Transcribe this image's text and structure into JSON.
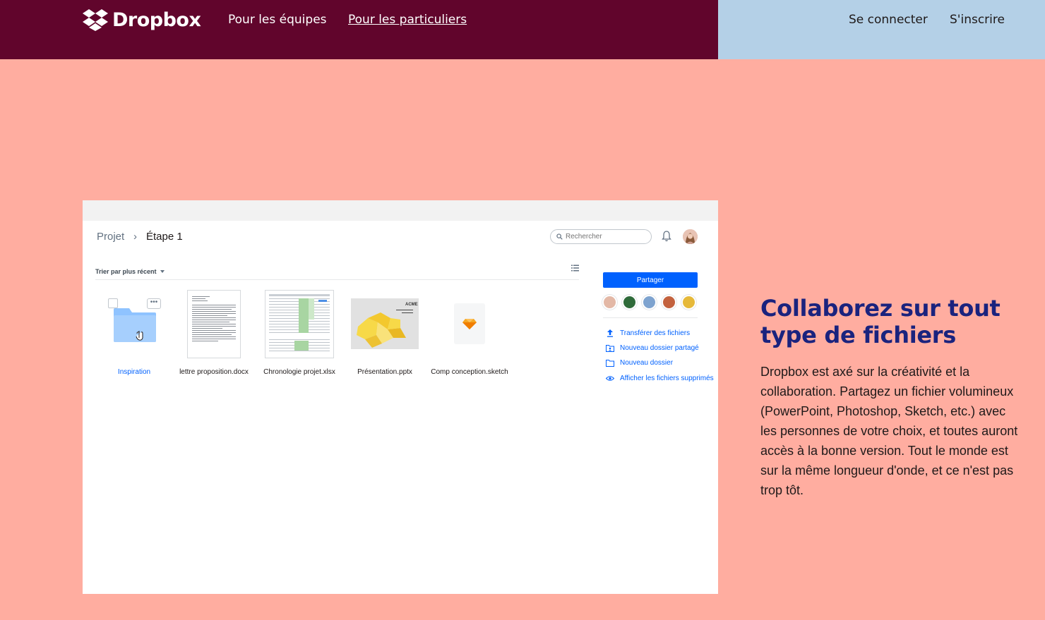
{
  "header": {
    "logo_text": "Dropbox",
    "nav": [
      {
        "label": "Pour les équipes"
      },
      {
        "label": "Pour les particuliers"
      }
    ],
    "login": "Se connecter",
    "signup": "S'inscrire"
  },
  "app": {
    "breadcrumb": {
      "project": "Projet",
      "separator": "›",
      "step": "Étape 1"
    },
    "search_placeholder": "Rechercher",
    "sort_label": "Trier par plus récent",
    "files": [
      {
        "name": "Inspiration"
      },
      {
        "name": "lettre proposition.docx"
      },
      {
        "name": "Chronologie projet.xlsx"
      },
      {
        "name": "Présentation.pptx"
      },
      {
        "name": "Comp conception.sketch"
      }
    ],
    "presentation_brand": "ACME",
    "share_button": "Partager",
    "actions": [
      {
        "label": "Transférer des fichiers"
      },
      {
        "label": "Nouveau dossier partagé"
      },
      {
        "label": "Nouveau dossier"
      },
      {
        "label": "Afficher les fichiers supprimés"
      }
    ]
  },
  "feature": {
    "title": "Collaborez sur tout type de fichiers",
    "text": "Dropbox est axé sur la créativité et la collaboration. Partagez un fichier volumineux (PowerPoint, Photoshop, Sketch, etc.) avec les personnes de votre choix, et toutes auront accès à la bonne version. Tout le monde est sur la même longueur d'onde, et ce n'est pas trop tôt."
  },
  "colors": {
    "header_bg": "#61052c",
    "header_right_bg": "#b4d0e7",
    "page_bg": "#ffada0",
    "title_color": "#1a237e",
    "accent": "#0061fe"
  }
}
